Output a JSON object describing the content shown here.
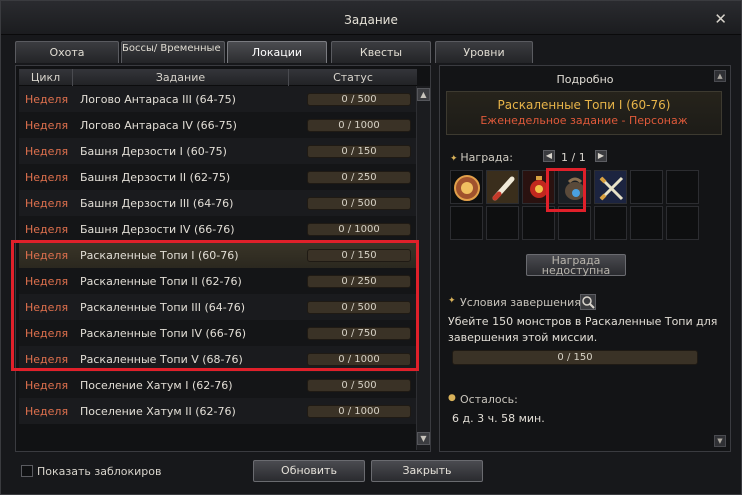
{
  "window": {
    "title": "Задание"
  },
  "tabs": [
    {
      "label": "Охота"
    },
    {
      "label": "Боссы/ Временные Зоны"
    },
    {
      "label": "Локации"
    },
    {
      "label": "Квесты"
    },
    {
      "label": "Уровни"
    }
  ],
  "table": {
    "headers": {
      "cycle": "Цикл",
      "task": "Задание",
      "status": "Статус"
    },
    "rows": [
      {
        "cycle": "Неделя",
        "task": "Логово Антараса III (64-75)",
        "status": "0 / 500"
      },
      {
        "cycle": "Неделя",
        "task": "Логово Антараса IV (66-75)",
        "status": "0 / 1000"
      },
      {
        "cycle": "Неделя",
        "task": "Башня Дерзости I (60-75)",
        "status": "0 / 150"
      },
      {
        "cycle": "Неделя",
        "task": "Башня Дерзости II (62-75)",
        "status": "0 / 250"
      },
      {
        "cycle": "Неделя",
        "task": "Башня Дерзости III (64-76)",
        "status": "0 / 500"
      },
      {
        "cycle": "Неделя",
        "task": "Башня Дерзости IV (66-76)",
        "status": "0 / 1000"
      },
      {
        "cycle": "Неделя",
        "task": "Раскаленные Топи I (60-76)",
        "status": "0 / 150"
      },
      {
        "cycle": "Неделя",
        "task": "Раскаленные Топи II (62-76)",
        "status": "0 / 250"
      },
      {
        "cycle": "Неделя",
        "task": "Раскаленные Топи III (64-76)",
        "status": "0 / 500"
      },
      {
        "cycle": "Неделя",
        "task": "Раскаленные Топи IV (66-76)",
        "status": "0 / 750"
      },
      {
        "cycle": "Неделя",
        "task": "Раскаленные Топи V (68-76)",
        "status": "0 / 1000"
      },
      {
        "cycle": "Неделя",
        "task": "Поселение Хатум I (62-76)",
        "status": "0 / 500"
      },
      {
        "cycle": "Неделя",
        "task": "Поселение Хатум II (62-76)",
        "status": "0 / 1000"
      }
    ]
  },
  "details": {
    "title": "Подробно",
    "quest_name": "Раскаленные Топи I (60-76)",
    "quest_type": "Еженедельное задание  -  Персонаж",
    "reward_label": "Награда:",
    "reward_pager": "1 / 1",
    "reward_button": "Награда недоступна",
    "conditions_label": "Условия завершения:",
    "conditions_text": "Убейте 150 монстров в Раскаленные Топи для завершения этой миссии.",
    "progress": "0 / 150",
    "remaining_label": "Осталось:",
    "remaining_value": "6 д. 3 ч. 58 мин."
  },
  "footer": {
    "show_locked_label": "Показать заблокиров",
    "refresh_label": "Обновить",
    "close_label": "Закрыть"
  },
  "reward_items": [
    {
      "icon": "coin-token-icon"
    },
    {
      "icon": "scroll-icon"
    },
    {
      "icon": "lantern-icon"
    },
    {
      "icon": "pouch-icon"
    },
    {
      "icon": "crossed-swords-icon"
    }
  ],
  "colors": {
    "cycle_text": "#e0714e",
    "quest_name": "#e7b449",
    "quest_type": "#e05a3a",
    "highlight": "#e0202a"
  }
}
